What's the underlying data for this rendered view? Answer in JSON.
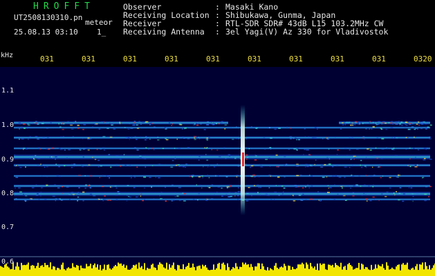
{
  "header": {
    "logo": "HROFFT",
    "filename": "UT2508130310.pn",
    "mode": "meteor",
    "datetime": "25.08.13 03:10",
    "page_indicator": "1_"
  },
  "station_info": [
    {
      "label": "Observer",
      "sep": ":",
      "value": "Masaki Kano"
    },
    {
      "label": "Receiving Location",
      "sep": ":",
      "value": "Shibukawa, Gunma, Japan"
    },
    {
      "label": "Receiver",
      "sep": ":",
      "value": "RTL-SDR SDR# 43dB L15 103.2MHz CW"
    },
    {
      "label": "Receiving Antenna",
      "sep": ":",
      "value": "3el Yagi(V) Az 330 for Vladivostok"
    }
  ],
  "spectrogram": {
    "unit_label": "kHz",
    "time_ticks": [
      "031",
      "031",
      "031",
      "031",
      "031",
      "031",
      "031",
      "031",
      "031",
      "0320"
    ],
    "freq_ticks": [
      "1.1",
      "1.0",
      "0.9",
      "0.8",
      "0.7",
      "0.6"
    ],
    "colors": {
      "background": "#000033",
      "low": "#0a2aa0",
      "mid": "#2bd0d8",
      "high": "#e83030",
      "level": "#f2e600"
    }
  }
}
